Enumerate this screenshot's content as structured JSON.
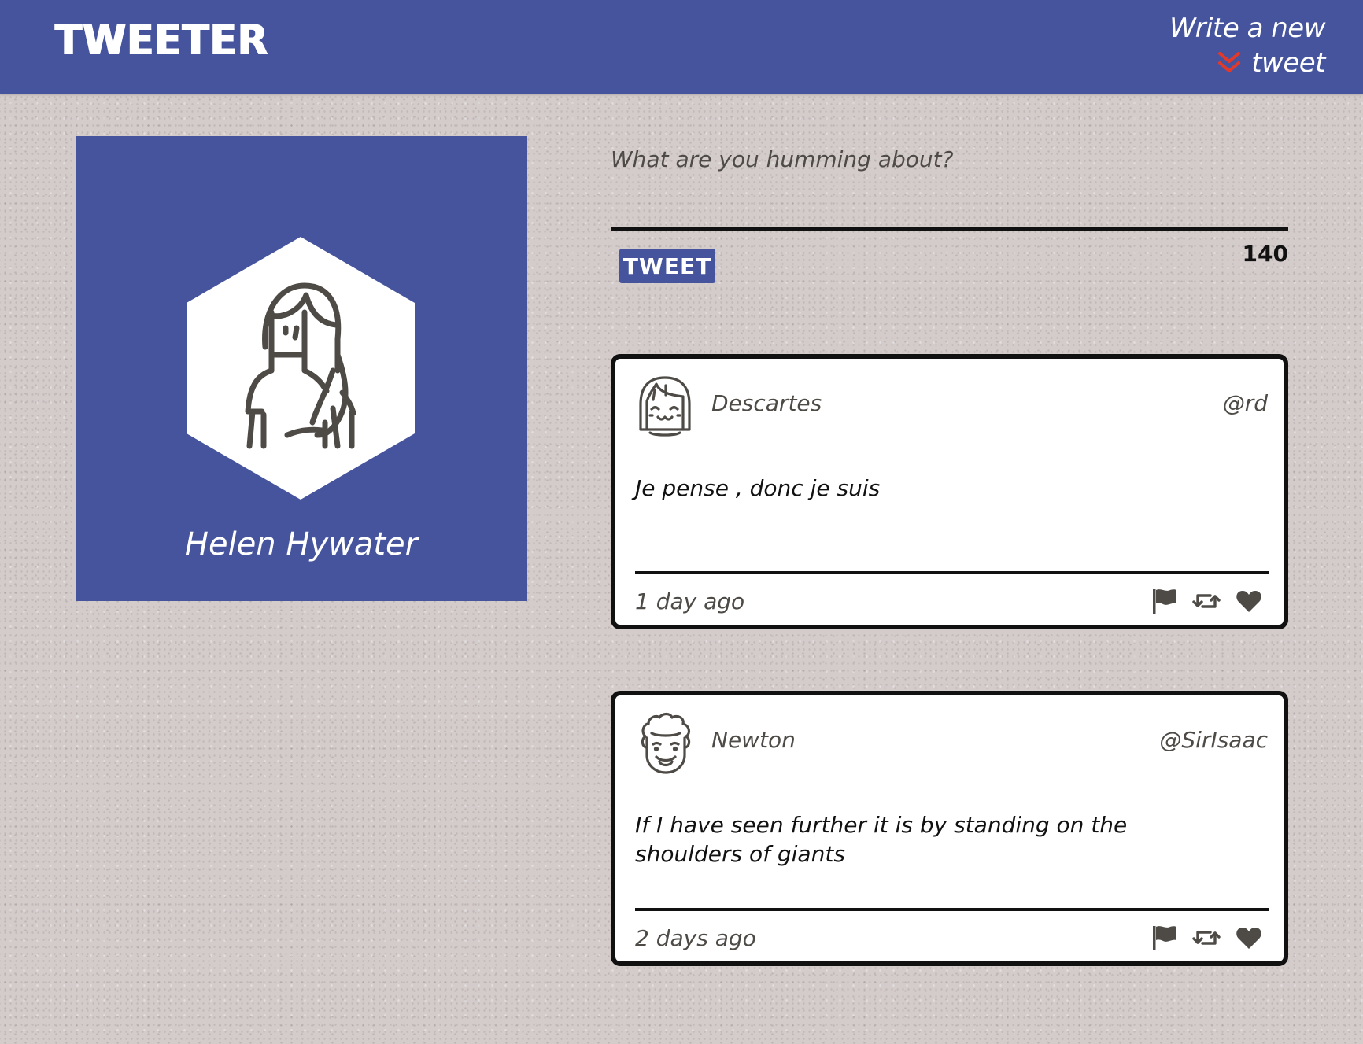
{
  "header": {
    "logo": "TWEETER",
    "compose_toggle_label": "Write a new tweet",
    "compose_toggle_icon": "double-chevron-down-icon",
    "accent_color": "#e3392b"
  },
  "colors": {
    "brand": "#45549d",
    "text": "#4e4b47",
    "ink": "#111111",
    "background": "#d4cbcb"
  },
  "profile": {
    "name": "Helen Hywater",
    "avatar_icon": "woman-avatar-icon"
  },
  "composer": {
    "placeholder": "What are you humming about?",
    "value": "",
    "button_label": "TWEET",
    "char_count": "140"
  },
  "tweets": [
    {
      "author": "Descartes",
      "handle": "@rd",
      "avatar_icon": "smiling-girl-avatar-icon",
      "text": "Je pense , donc je suis",
      "time": "1 day ago",
      "actions": [
        "flag-icon",
        "retweet-icon",
        "heart-icon"
      ]
    },
    {
      "author": "Newton",
      "handle": "@SirIsaac",
      "avatar_icon": "curly-hair-avatar-icon",
      "text": "If I have seen further it is by standing on the shoulders of giants",
      "time": "2 days ago",
      "actions": [
        "flag-icon",
        "retweet-icon",
        "heart-icon"
      ]
    }
  ]
}
